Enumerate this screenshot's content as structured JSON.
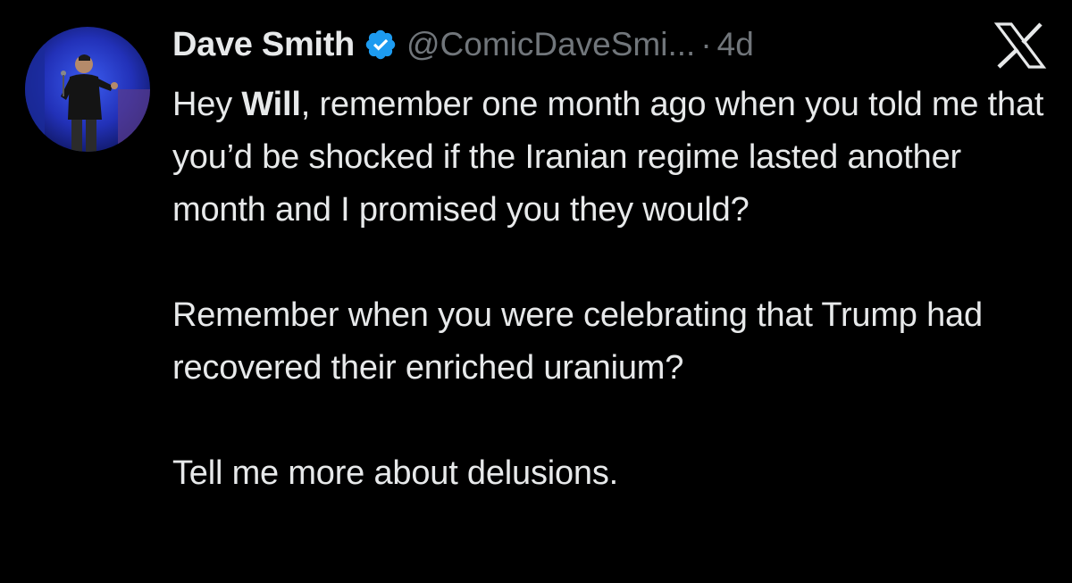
{
  "author": {
    "display_name": "Dave Smith",
    "handle": "@ComicDaveSmi...",
    "separator": "·",
    "time": "4d",
    "verified": true,
    "verified_color": "#1d9bf0"
  },
  "platform_icon": "x-logo-icon",
  "tweet": {
    "p1": {
      "before": "Hey ",
      "mention": "Will",
      "after": ", remember one month ago when you told me that you’d be shocked if the Iranian regime lasted another month and I promised you they would?"
    },
    "p2": "Remember when you were celebrating that Trump had recovered their enriched uranium?",
    "p3": "Tell me more about delusions."
  },
  "colors": {
    "background": "#000000",
    "text": "#e7e9ea",
    "muted": "#71767b",
    "stage_blue": "#2a3fd6"
  }
}
